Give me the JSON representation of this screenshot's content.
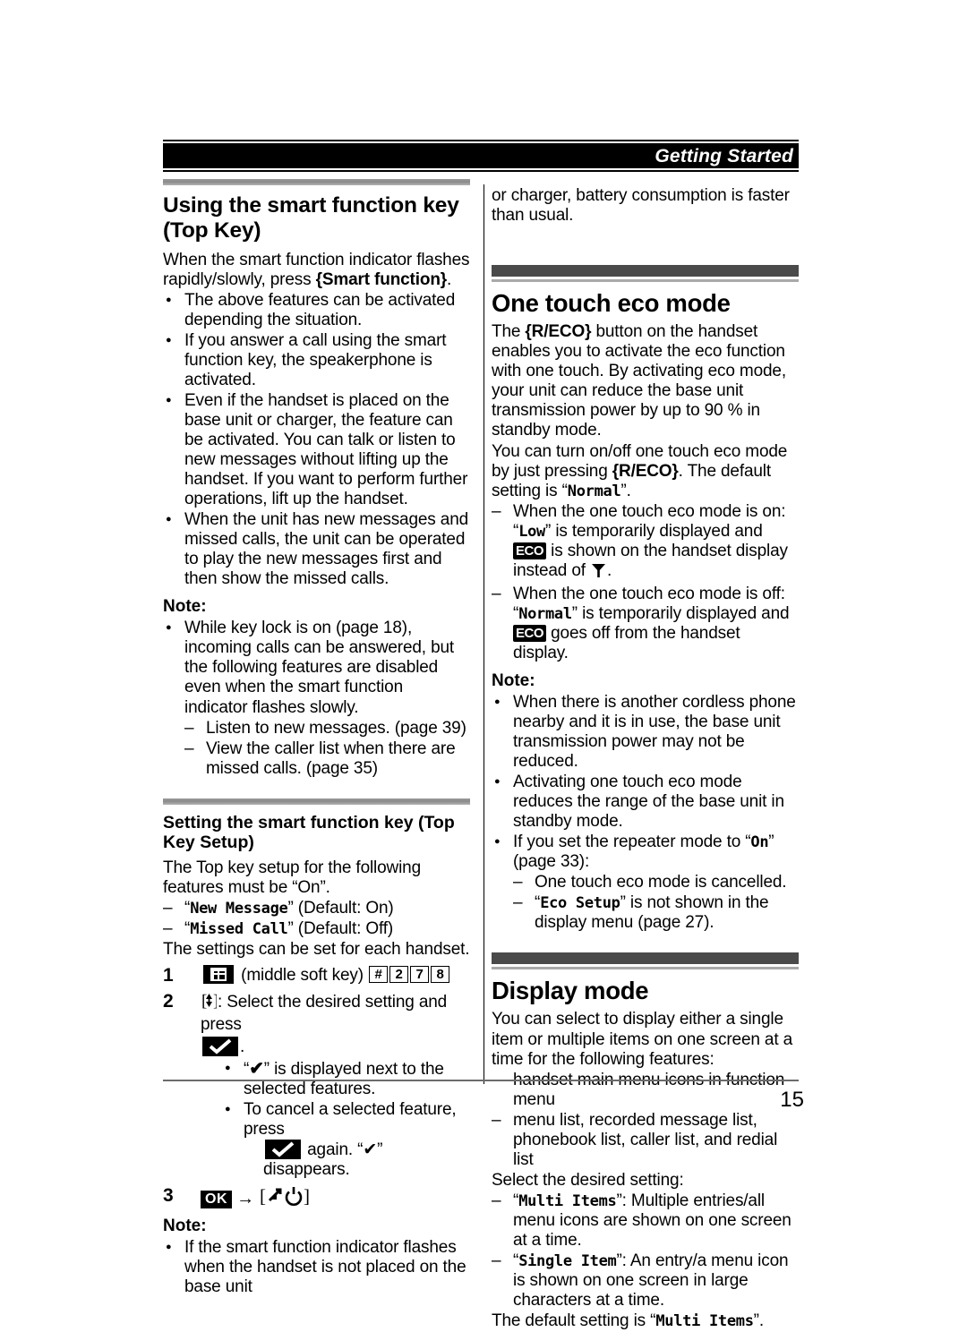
{
  "header": {
    "running_title": "Getting Started"
  },
  "page_number": "15",
  "left_column": {
    "section1": {
      "title": "Using the smart function key (Top Key)",
      "intro_pre": "When the smart function indicator flashes rapidly/slowly, press ",
      "intro_key": "{Smart function}",
      "intro_post": ".",
      "bullets": [
        "The above features can be activated depending the situation.",
        "If you answer a call using the smart function key, the speakerphone is activated.",
        "Even if the handset is placed on the base unit or charger, the feature can be activated. You can talk or listen to new messages without lifting up the handset. If you want to perform further operations, lift up the handset.",
        "When the unit has new messages and missed calls, the unit can be operated to play the new messages first and then show the missed calls."
      ],
      "note_label": "Note:",
      "note_bullet": "While key lock is on (page 18), incoming calls can be answered, but the following features are disabled even when the smart function indicator flashes slowly.",
      "note_sub_dashes": [
        "Listen to new messages. (page 39)",
        "View the caller list when there are missed calls. (page 35)"
      ]
    },
    "section2": {
      "title": "Setting the smart function key (Top Key Setup)",
      "intro": "The Top key setup for the following features must be “On”.",
      "feature_dashes": [
        {
          "quote_open": "“",
          "mono": "New Message",
          "quote_close": "”",
          "rest": " (Default: On)"
        },
        {
          "quote_open": "“",
          "mono": "Missed Call",
          "quote_close": "”",
          "rest": " (Default: Off)"
        }
      ],
      "after_features": "The settings can be set for each handset.",
      "steps": [
        {
          "num": "1",
          "icon": "softkey-grid-icon",
          "text_mid": "(middle soft key)",
          "keys": [
            "#",
            "2",
            "7",
            "8"
          ]
        },
        {
          "num": "2",
          "navkey": "{navigator-up-down}",
          "text": ": Select the desired setting and press",
          "after_icon_text": ".",
          "sub_bullets": [
            {
              "pre": "“",
              "glyph": "✔",
              "post": "” is displayed next to the selected features."
            },
            {
              "pre": "To cancel a selected feature, press",
              "post": "again. “✔” disappears."
            }
          ]
        },
        {
          "num": "3",
          "ok_label": "OK",
          "arrow": "→",
          "end_key": "{off-power}"
        }
      ],
      "note_label": "Note:",
      "note_bullet": "If the smart function indicator flashes when the handset is not placed on the base unit"
    }
  },
  "right_column": {
    "continuation": "or charger, battery consumption is faster than usual.",
    "section_eco": {
      "title": "One touch eco mode",
      "para1_pre": "The ",
      "para1_key": "{R/ECO}",
      "para1_post": " button on the handset enables you to activate the eco function with one touch. By activating eco mode, your unit can reduce the base unit transmission power by up to 90 % in standby mode.",
      "para2_pre": "You can turn on/off one touch eco mode by just pressing ",
      "para2_key": "{R/ECO}",
      "para2_mid": ". The default setting is ",
      "para2_quote_open": "“",
      "para2_mono": "Normal",
      "para2_quote_close": "”",
      "para2_end": ".",
      "dash_items": [
        {
          "lead": "When the one touch eco mode is on: ",
          "mono_quoted": "Low",
          "mid": " is temporarily displayed and ",
          "badge": "ECO",
          "tail": " is shown on the handset display instead of ",
          "tail_icon": "antenna-icon",
          "tail_end": "."
        },
        {
          "lead": "When the one touch eco mode is off: ",
          "mono_quoted": "Normal",
          "mid": " is temporarily displayed and ",
          "badge": "ECO",
          "tail": " goes off from the handset display."
        }
      ],
      "note_label": "Note:",
      "note_bullets": [
        "When there is another cordless phone nearby and it is in use, the base unit transmission power may not be reduced.",
        "Activating one touch eco mode reduces the range of the base unit in standby mode."
      ],
      "note_bullet_repeater_pre": "If you set the repeater mode to “",
      "note_bullet_repeater_mono": "On",
      "note_bullet_repeater_post": "” (page 33):",
      "repeater_sub_dashes": [
        {
          "plain": "One touch eco mode is cancelled."
        },
        {
          "quote_open": "“",
          "mono": "Eco Setup",
          "quote_close": "”",
          "rest": " is not shown in the display menu (page 27)."
        }
      ]
    },
    "section_display": {
      "title": "Display mode",
      "intro": "You can select to display either a single item or multiple items on one screen at a time for the following features:",
      "feature_dashes": [
        "handset main menu icons in function menu",
        "menu list, recorded message list, phonebook list, caller list, and redial list"
      ],
      "select_line": "Select the desired setting:",
      "setting_dashes": [
        {
          "quote_open": "“",
          "mono": "Multi Items",
          "quote_close": "”",
          "rest": ": Multiple entries/all menu icons are shown on one screen at a time."
        },
        {
          "quote_open": "“",
          "mono": "Single Item",
          "quote_close": "”",
          "rest": ": An entry/a menu icon is shown on one screen in large characters at a time."
        }
      ],
      "default_pre": "The default setting is “",
      "default_mono": "Multi Items",
      "default_post": "”."
    }
  }
}
